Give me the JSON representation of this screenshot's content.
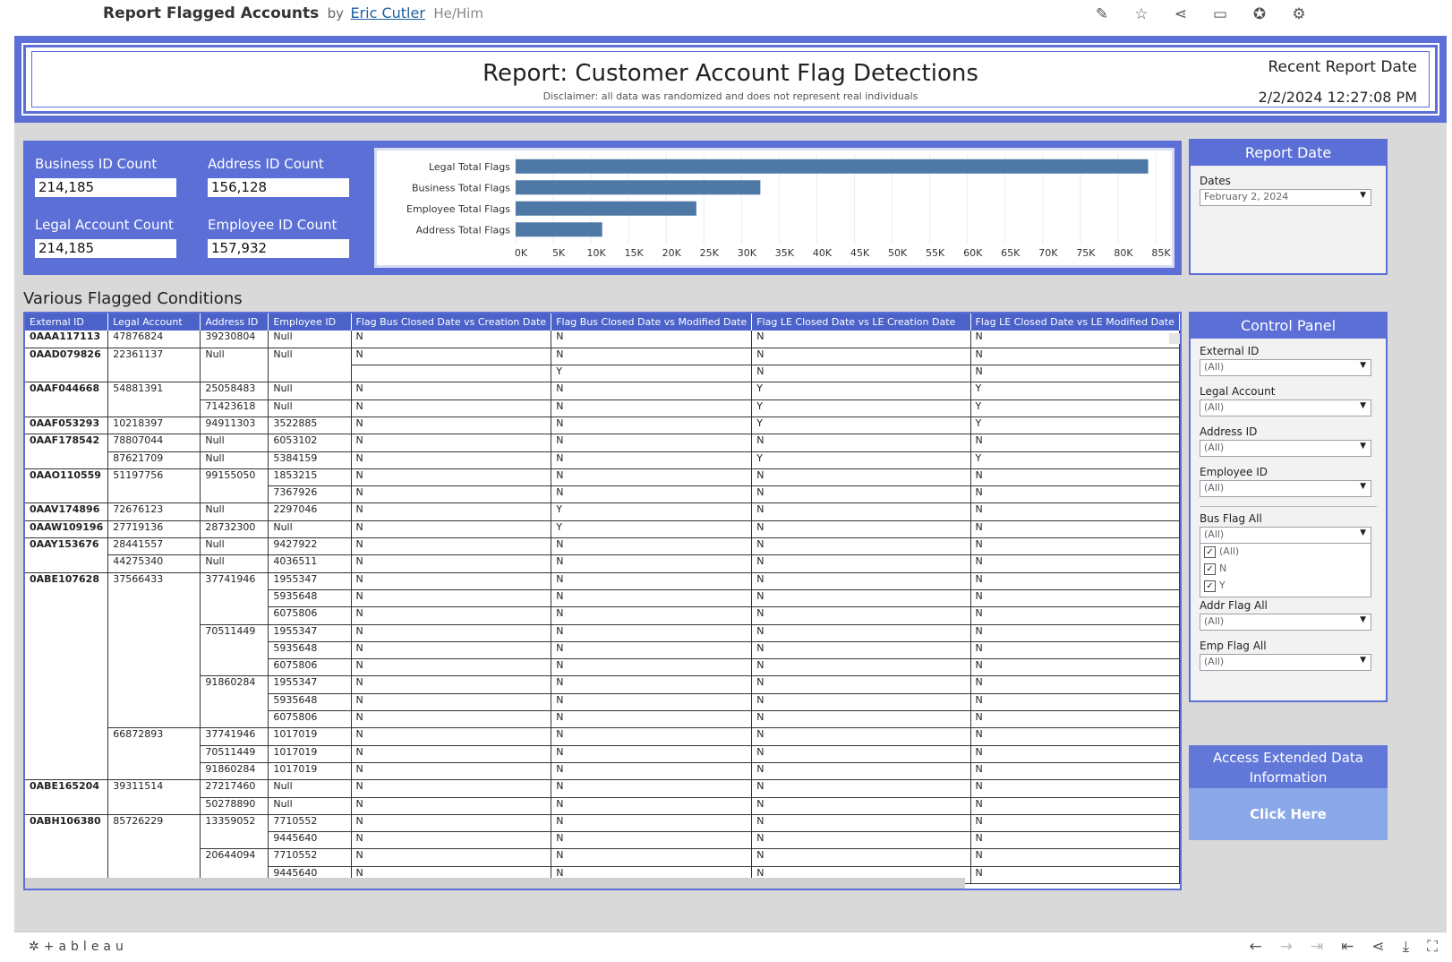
{
  "topbar": {
    "title": "Report Flagged Accounts",
    "by": "by",
    "author": "Eric Cutler",
    "pronouns": "He/Him",
    "icons": [
      "edit-icon",
      "star-icon",
      "share-icon",
      "comment-icon",
      "badge-icon",
      "gear-icon"
    ]
  },
  "header": {
    "title": "Report: Customer Account Flag Detections",
    "disclaimer": "Disclaimer: all data was randomized and does not represent real individuals",
    "recent_label": "Recent Report Date",
    "recent_date": "2/2/2024 12:27:08 PM"
  },
  "kpis": {
    "business_label": "Business ID Count",
    "business_value": "214,185",
    "address_label": "Address ID Count",
    "address_value": "156,128",
    "legal_label": "Legal Account Count",
    "legal_value": "214,185",
    "employee_label": "Employee ID Count",
    "employee_value": "157,932"
  },
  "chart_data": {
    "type": "bar",
    "orientation": "horizontal",
    "categories": [
      "Legal Total Flags",
      "Business Total Flags",
      "Employee Total Flags",
      "Address Total Flags"
    ],
    "values": [
      84000,
      32500,
      24000,
      11500
    ],
    "xlim": [
      0,
      85000
    ],
    "xticks": [
      "0K",
      "5K",
      "10K",
      "15K",
      "20K",
      "25K",
      "30K",
      "35K",
      "40K",
      "45K",
      "50K",
      "55K",
      "60K",
      "65K",
      "70K",
      "75K",
      "80K",
      "85K"
    ],
    "grid": true,
    "bar_color": "#4e79a7"
  },
  "report_date_panel": {
    "title": "Report Date",
    "dates_label": "Dates",
    "dates_value": "February 2, 2024"
  },
  "control_panel": {
    "title": "Control Panel",
    "external_label": "External ID",
    "external_value": "(All)",
    "legal_label": "Legal Account",
    "legal_value": "(All)",
    "address_label": "Address ID",
    "address_value": "(All)",
    "employee_label": "Employee ID",
    "employee_value": "(All)",
    "bus_label": "Bus Flag All",
    "bus_value": "(All)",
    "bus_options": [
      "(All)",
      "N",
      "Y"
    ],
    "addr_label": "Addr Flag All",
    "addr_value": "(All)",
    "emp_label": "Emp Flag All",
    "emp_value": "(All)"
  },
  "access": {
    "title_line1": "Access Extended Data",
    "title_line2": "Information",
    "button": "Click Here"
  },
  "table": {
    "title": "Various Flagged Conditions",
    "columns": [
      "External ID",
      "Legal Account",
      "Address ID",
      "Employee ID",
      "Flag Bus Closed Date vs Creation Date",
      "Flag Bus Closed Date vs Modified Date",
      "Flag LE Closed Date vs LE Creation Date",
      "Flag LE Closed Date vs LE Modified Date"
    ],
    "rows": [
      [
        "0AAA117113",
        "47876824",
        "39230804",
        "Null",
        "N",
        "N",
        "N",
        "N"
      ],
      [
        "0AAD079826",
        "22361137",
        "Null",
        "Null",
        "N",
        "N",
        "N",
        "N"
      ],
      [
        "",
        "",
        "",
        "",
        "",
        "Y",
        "N",
        "N"
      ],
      [
        "0AAF044668",
        "54881391",
        "25058483",
        "Null",
        "N",
        "N",
        "Y",
        "Y"
      ],
      [
        "",
        "",
        "71423618",
        "Null",
        "N",
        "N",
        "Y",
        "Y"
      ],
      [
        "0AAF053293",
        "10218397",
        "94911303",
        "3522885",
        "N",
        "N",
        "Y",
        "Y"
      ],
      [
        "0AAF178542",
        "78807044",
        "Null",
        "6053102",
        "N",
        "N",
        "N",
        "N"
      ],
      [
        "",
        "87621709",
        "Null",
        "5384159",
        "N",
        "N",
        "Y",
        "Y"
      ],
      [
        "0AAO110559",
        "51197756",
        "99155050",
        "1853215",
        "N",
        "N",
        "N",
        "N"
      ],
      [
        "",
        "",
        "",
        "7367926",
        "N",
        "N",
        "N",
        "N"
      ],
      [
        "0AAV174896",
        "72676123",
        "Null",
        "2297046",
        "N",
        "Y",
        "N",
        "N"
      ],
      [
        "0AAW109196",
        "27719136",
        "28732300",
        "Null",
        "N",
        "Y",
        "N",
        "N"
      ],
      [
        "0AAY153676",
        "28441557",
        "Null",
        "9427922",
        "N",
        "N",
        "N",
        "N"
      ],
      [
        "",
        "44275340",
        "Null",
        "4036511",
        "N",
        "N",
        "N",
        "N"
      ],
      [
        "0ABE107628",
        "37566433",
        "37741946",
        "1955347",
        "N",
        "N",
        "N",
        "N"
      ],
      [
        "",
        "",
        "",
        "5935648",
        "N",
        "N",
        "N",
        "N"
      ],
      [
        "",
        "",
        "",
        "6075806",
        "N",
        "N",
        "N",
        "N"
      ],
      [
        "",
        "",
        "70511449",
        "1955347",
        "N",
        "N",
        "N",
        "N"
      ],
      [
        "",
        "",
        "",
        "5935648",
        "N",
        "N",
        "N",
        "N"
      ],
      [
        "",
        "",
        "",
        "6075806",
        "N",
        "N",
        "N",
        "N"
      ],
      [
        "",
        "",
        "91860284",
        "1955347",
        "N",
        "N",
        "N",
        "N"
      ],
      [
        "",
        "",
        "",
        "5935648",
        "N",
        "N",
        "N",
        "N"
      ],
      [
        "",
        "",
        "",
        "6075806",
        "N",
        "N",
        "N",
        "N"
      ],
      [
        "",
        "66872893",
        "37741946",
        "1017019",
        "N",
        "N",
        "N",
        "N"
      ],
      [
        "",
        "",
        "70511449",
        "1017019",
        "N",
        "N",
        "N",
        "N"
      ],
      [
        "",
        "",
        "91860284",
        "1017019",
        "N",
        "N",
        "N",
        "N"
      ],
      [
        "0ABE165204",
        "39311514",
        "27217460",
        "Null",
        "N",
        "N",
        "N",
        "N"
      ],
      [
        "",
        "",
        "50278890",
        "Null",
        "N",
        "N",
        "N",
        "N"
      ],
      [
        "0ABH106380",
        "85726229",
        "13359052",
        "7710552",
        "N",
        "N",
        "N",
        "N"
      ],
      [
        "",
        "",
        "",
        "9445640",
        "N",
        "N",
        "N",
        "N"
      ],
      [
        "",
        "",
        "20644094",
        "7710552",
        "N",
        "N",
        "N",
        "N"
      ],
      [
        "",
        "",
        "",
        "9445640",
        "N",
        "N",
        "N",
        "N"
      ]
    ]
  },
  "bottombar": {
    "logo": "+ableau",
    "icons": [
      "undo-icon",
      "redo-icon",
      "revert-icon",
      "reset-icon",
      "share-icon",
      "download-icon",
      "fullscreen-icon"
    ]
  }
}
